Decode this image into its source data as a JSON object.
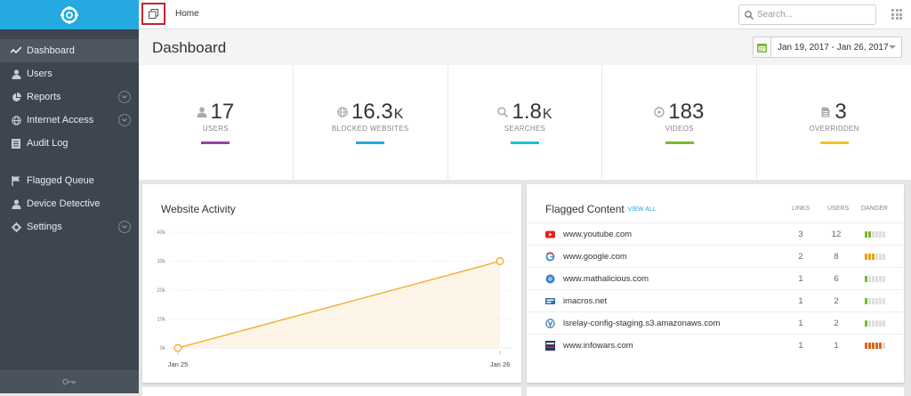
{
  "topbar": {
    "breadcrumb": "Home",
    "search_placeholder": "Search..."
  },
  "sidebar": {
    "items": [
      {
        "label": "Dashboard",
        "icon": "activity-icon",
        "active": true
      },
      {
        "label": "Users",
        "icon": "user-icon"
      },
      {
        "label": "Reports",
        "icon": "pie-chart-icon",
        "expandable": true
      },
      {
        "label": "Internet Access",
        "icon": "globe-icon",
        "expandable": true
      },
      {
        "label": "Audit Log",
        "icon": "list-icon"
      },
      {
        "label": "Flagged Queue",
        "icon": "flag-icon"
      },
      {
        "label": "Device Detective",
        "icon": "user-icon"
      },
      {
        "label": "Settings",
        "icon": "gear-icon",
        "expandable": true
      }
    ]
  },
  "header": {
    "title": "Dashboard",
    "date_range": "Jan 19, 2017 - Jan 26, 2017"
  },
  "stats": [
    {
      "value": "17",
      "unit": "",
      "label": "USERS",
      "icon": "user-icon",
      "color": "#9b3fb0"
    },
    {
      "value": "16.3",
      "unit": "K",
      "label": "BLOCKED WEBSITES",
      "icon": "globe-icon",
      "color": "#24a9e0"
    },
    {
      "value": "1.8",
      "unit": "K",
      "label": "SEARCHES",
      "icon": "search-icon",
      "color": "#1ebfd0"
    },
    {
      "value": "183",
      "unit": "",
      "label": "VIDEOS",
      "icon": "play-icon",
      "color": "#7cb82f"
    },
    {
      "value": "3",
      "unit": "",
      "label": "OVERRIDDEN",
      "icon": "document-icon",
      "color": "#f3c12f"
    }
  ],
  "activity": {
    "title": "Website Activity",
    "chart_data": {
      "type": "area",
      "x": [
        "Jan 25",
        "Jan 26"
      ],
      "values": [
        0,
        30000
      ],
      "yticks": [
        "0k",
        "10k",
        "20k",
        "30k",
        "40k"
      ],
      "ylim": [
        0,
        40000
      ],
      "color": "#f5a623"
    }
  },
  "flagged": {
    "title": "Flagged Content",
    "view_all": "VIEW ALL",
    "headers": {
      "links": "LINKS",
      "users": "USERS",
      "danger": "DANGER"
    },
    "rows": [
      {
        "domain": "www.youtube.com",
        "icon": "youtube-icon",
        "links": "3",
        "users": "12",
        "danger": 2,
        "danger_color": "#7cb82f"
      },
      {
        "domain": "www.google.com",
        "icon": "google-icon",
        "links": "2",
        "users": "8",
        "danger": 3,
        "danger_color": "#e8a317"
      },
      {
        "domain": "www.mathalicious.com",
        "icon": "mathalicious-icon",
        "links": "1",
        "users": "6",
        "danger": 1,
        "danger_color": "#7cb82f"
      },
      {
        "domain": "imacros.net",
        "icon": "imacros-icon",
        "links": "1",
        "users": "2",
        "danger": 1,
        "danger_color": "#7cb82f"
      },
      {
        "domain": "lsrelay-config-staging.s3.amazonaws.com",
        "icon": "lsrelay-icon",
        "links": "1",
        "users": "2",
        "danger": 1,
        "danger_color": "#7cb82f"
      },
      {
        "domain": "www.infowars.com",
        "icon": "infowars-icon",
        "links": "1",
        "users": "1",
        "danger": 5,
        "danger_color": "#e0641c"
      }
    ]
  }
}
